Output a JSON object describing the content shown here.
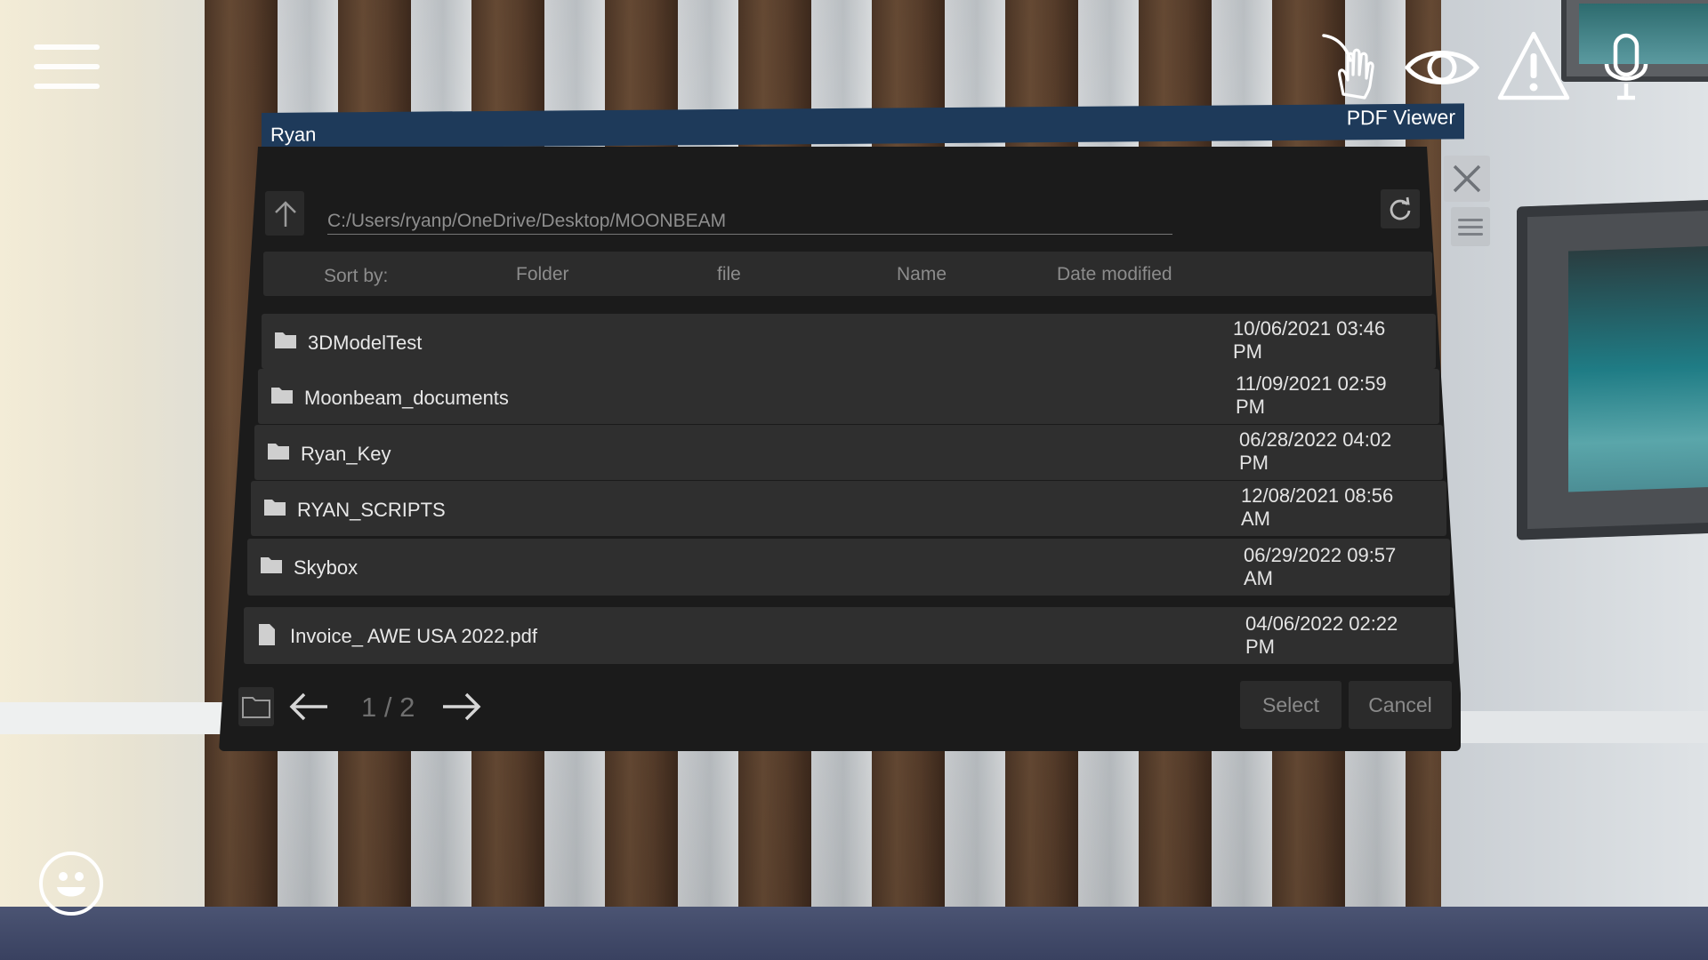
{
  "window": {
    "user_label": "Ryan",
    "app_label": "PDF Viewer"
  },
  "path": {
    "value": "C:/Users/ryanp/OneDrive/Desktop/MOONBEAM"
  },
  "sort": {
    "label": "Sort by:",
    "options": [
      "Folder",
      "file",
      "Name",
      "Date modified"
    ]
  },
  "rows": [
    {
      "type": "folder",
      "name": "3DModelTest",
      "date_line1": "10/06/2021 03:46",
      "date_line2": "PM"
    },
    {
      "type": "folder",
      "name": "Moonbeam_documents",
      "date_line1": "11/09/2021 02:59",
      "date_line2": "PM"
    },
    {
      "type": "folder",
      "name": "Ryan_Key",
      "date_line1": "06/28/2022 04:02",
      "date_line2": "PM"
    },
    {
      "type": "folder",
      "name": "RYAN_SCRIPTS",
      "date_line1": "12/08/2021 08:56",
      "date_line2": "AM"
    },
    {
      "type": "folder",
      "name": "Skybox",
      "date_line1": "06/29/2022 09:57",
      "date_line2": "AM"
    },
    {
      "type": "file",
      "name": "Invoice_ AWE USA 2022.pdf",
      "date_line1": "04/06/2022 02:22",
      "date_line2": "PM"
    }
  ],
  "pagination": {
    "page": "1 / 2"
  },
  "buttons": {
    "select": "Select",
    "cancel": "Cancel"
  },
  "hud": {
    "icons": [
      "menu-icon",
      "hand-gesture-icon",
      "eye-icon",
      "warning-icon",
      "microphone-icon",
      "emoji-icon"
    ]
  },
  "colors": {
    "titlebar": "#1e3a5a",
    "panel": "#1b1b1b",
    "row": "#2f2f2f",
    "text": "#e8e8e8",
    "muted": "#8c8c8c"
  }
}
